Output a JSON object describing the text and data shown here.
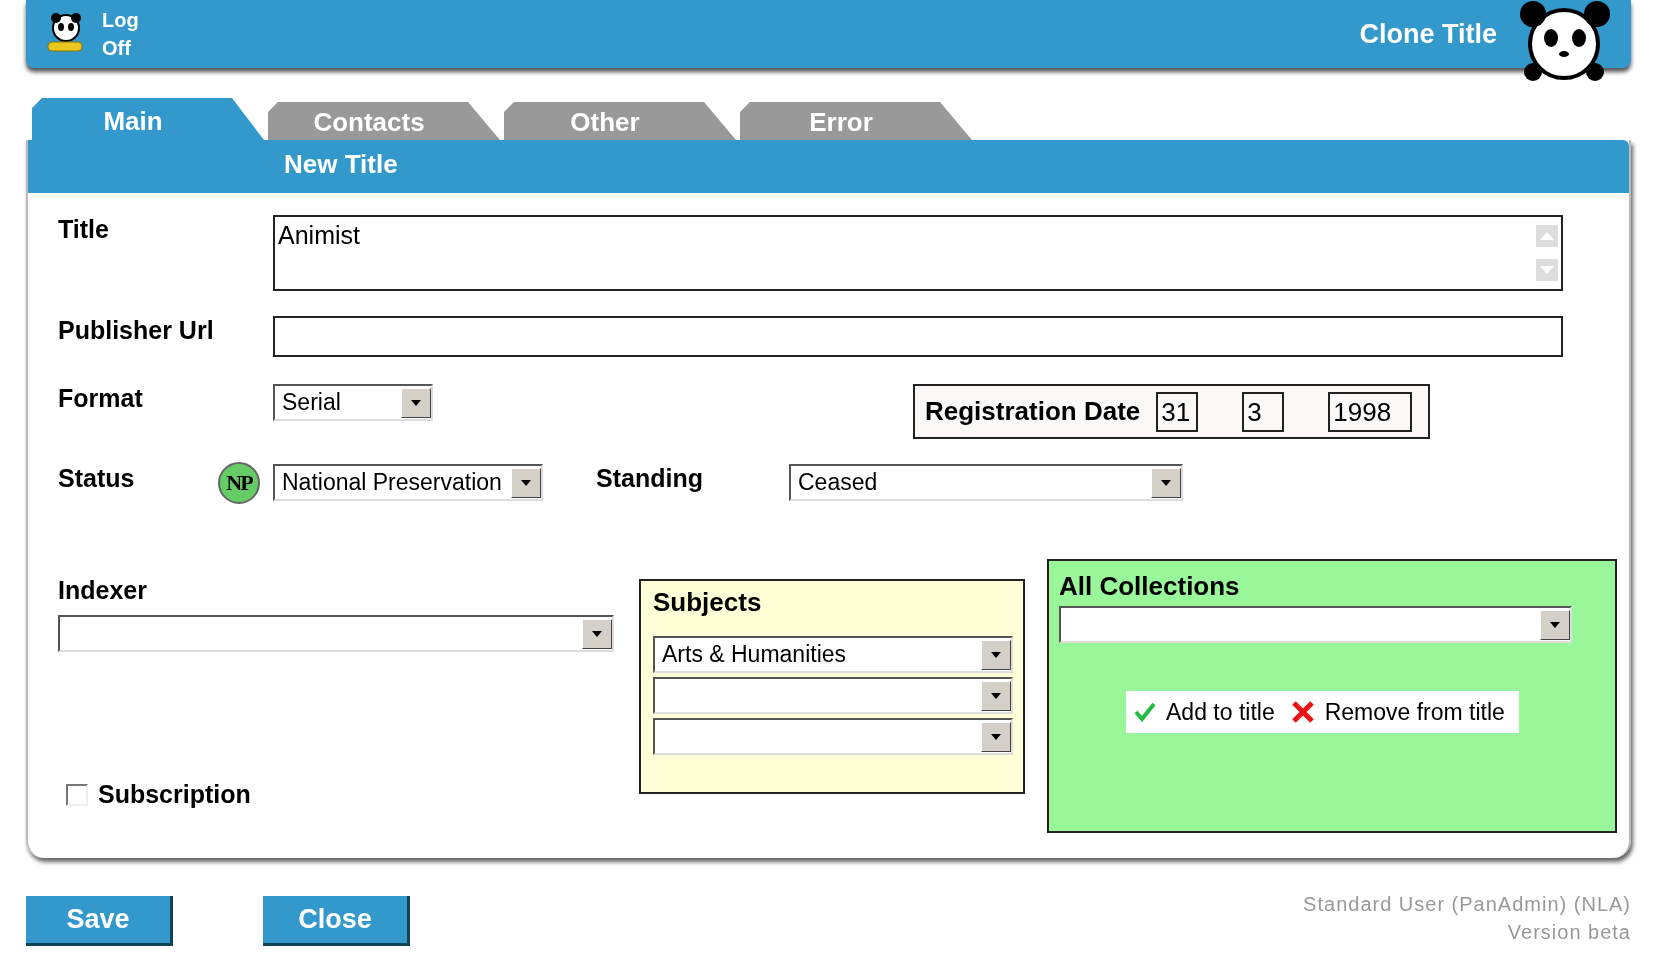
{
  "header": {
    "logoff": "Log Off",
    "page_title": "Clone Title"
  },
  "tabs": [
    {
      "label": "Main",
      "selected": true
    },
    {
      "label": "Contacts",
      "selected": false
    },
    {
      "label": "Other",
      "selected": false
    },
    {
      "label": "Error",
      "selected": false
    }
  ],
  "section_title": "New Title",
  "form": {
    "title": {
      "label": "Title",
      "value": "Animist"
    },
    "publisher_url": {
      "label": "Publisher Url"
    },
    "format": {
      "label": "Format",
      "value": "Serial"
    },
    "registration_date": {
      "label": "Registration Date",
      "day": "31",
      "month": "3",
      "year": "1998"
    },
    "status": {
      "label": "Status",
      "badge": "NP",
      "value": "National Preservation"
    },
    "standing": {
      "label": "Standing",
      "value": "Ceased"
    },
    "indexer": {
      "label": "Indexer"
    },
    "subscription": {
      "label": "Subscription",
      "checked": false
    },
    "subjects": {
      "title": "Subjects",
      "dropdowns": [
        {
          "kind": "filled",
          "value": "Arts & Humanities"
        },
        {
          "kind": "empty"
        },
        {
          "kind": "empty"
        }
      ]
    },
    "collections": {
      "title": "All Collections",
      "add": "Add to title",
      "remove": "Remove from title"
    }
  },
  "buttons": [
    "Save",
    "Close"
  ],
  "footer": {
    "user": "Standard User (PanAdmin) (NLA)",
    "version": "Version beta"
  }
}
